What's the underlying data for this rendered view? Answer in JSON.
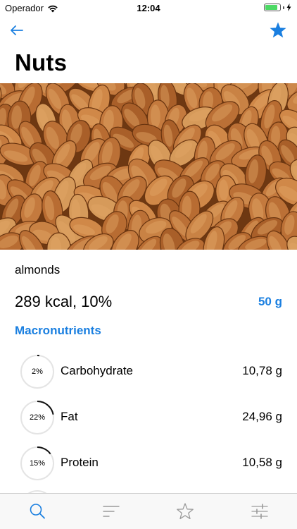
{
  "status_bar": {
    "carrier": "Operador",
    "time": "12:04",
    "battery_level": 0.85
  },
  "nav": {
    "back_icon": "arrow-left-icon",
    "favorite_icon": "star-filled-icon"
  },
  "page": {
    "title": "Nuts",
    "image_icon": "almonds-photo"
  },
  "food": {
    "name": "almonds",
    "energy": "289 kcal, 10%",
    "portion": "50 g"
  },
  "macros": {
    "title": "Macronutrients",
    "items": [
      {
        "percent": "2%",
        "fraction": 0.02,
        "name": "Carbohydrate",
        "value": "10,78 g"
      },
      {
        "percent": "22%",
        "fraction": 0.22,
        "name": "Fat",
        "value": "24,96 g"
      },
      {
        "percent": "15%",
        "fraction": 0.15,
        "name": "Protein",
        "value": "10,58 g"
      }
    ]
  },
  "tab_bar": {
    "items": [
      {
        "icon": "search-icon",
        "active": true
      },
      {
        "icon": "list-sort-icon",
        "active": false
      },
      {
        "icon": "star-outline-icon",
        "active": false
      },
      {
        "icon": "sliders-icon",
        "active": false
      }
    ]
  },
  "colors": {
    "accent": "#1a7fe0",
    "inactive": "#9a9a9a"
  }
}
